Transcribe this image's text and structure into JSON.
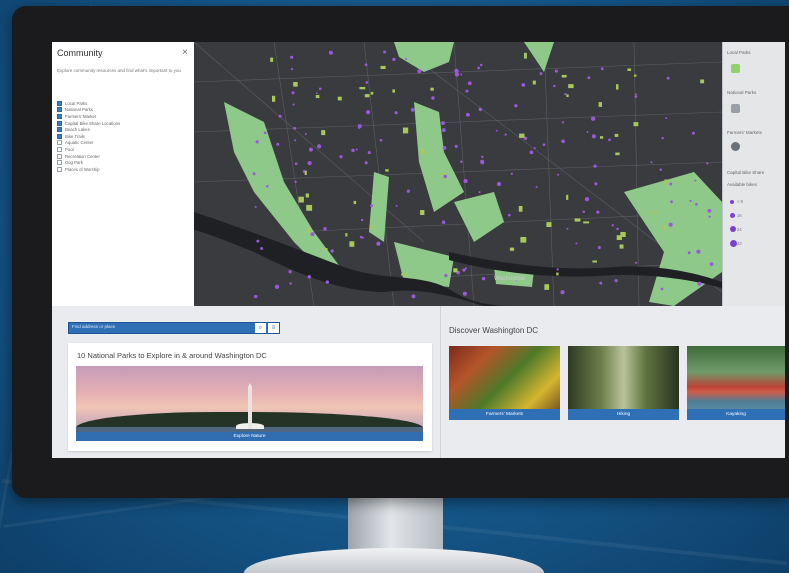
{
  "layers_panel": {
    "title": "Community",
    "close_glyph": "×",
    "description": "Explore community resources and find what's important to you",
    "layers": [
      {
        "label": "Local Parks",
        "checked": true
      },
      {
        "label": "National Parks",
        "checked": true
      },
      {
        "label": "Farmers' Market",
        "checked": true
      },
      {
        "label": "Capital Bike Share Locations",
        "checked": true
      },
      {
        "label": "Beach Lakes",
        "checked": true
      },
      {
        "label": "Bike Trails",
        "checked": true
      },
      {
        "label": "Aquatic Center",
        "checked": false
      },
      {
        "label": "Pool",
        "checked": false
      },
      {
        "label": "Recreation Center",
        "checked": false
      },
      {
        "label": "Dog Park",
        "checked": false
      },
      {
        "label": "Places of Worship",
        "checked": false
      }
    ]
  },
  "map": {
    "label": "Washington",
    "colors": {
      "land": "#3a3b3f",
      "water": "#1f2023",
      "park": "#8fc98a",
      "poi": "#9b59d9",
      "street": "#6b6c72"
    }
  },
  "legend": {
    "items": [
      {
        "label": "Local Parks",
        "icon": "park-square-icon",
        "color": "#8fd16a"
      },
      {
        "label": "National Parks",
        "icon": "park-square-icon",
        "color": "#9aa0a6"
      },
      {
        "label": "Farmers' Markets",
        "icon": "market-icon",
        "color": "#6a7078"
      },
      {
        "label": "Capital Bike Share",
        "icon": "",
        "color": ""
      }
    ],
    "sub_label": "Available bikes",
    "dot_values": [
      "< 8",
      "16",
      "24",
      "32"
    ]
  },
  "search": {
    "placeholder": "Find address or place",
    "button_glyphs": [
      "⌕",
      "≡"
    ]
  },
  "article": {
    "title": "10 National Parks to Explore in & around Washington DC",
    "photo_caption": "Explore Nature"
  },
  "discover": {
    "title": "Discover Washington DC",
    "tiles": [
      {
        "caption": "Farmers' Markets"
      },
      {
        "caption": "Hiking"
      },
      {
        "caption": "Kayaking"
      }
    ]
  }
}
